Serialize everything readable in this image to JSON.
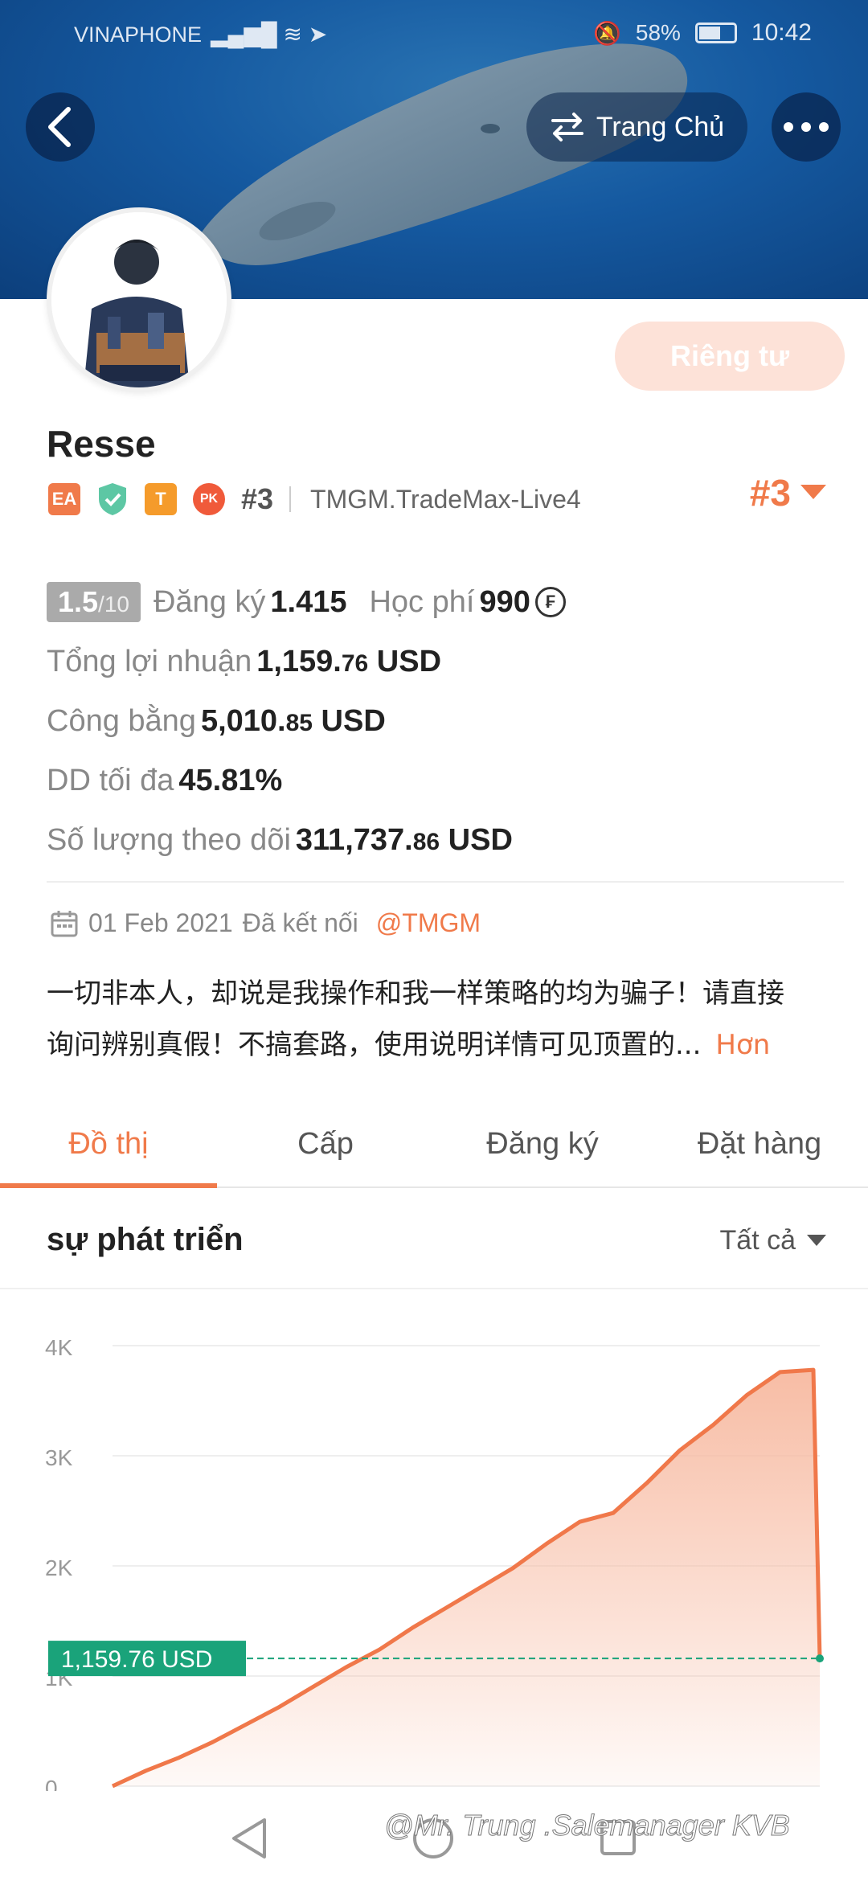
{
  "status_bar": {
    "carrier": "VINAPHONE",
    "battery": "58%",
    "time": "10:42"
  },
  "header": {
    "home_label": "Trang Chủ",
    "private_label": "Riêng tư"
  },
  "profile": {
    "name": "Resse",
    "badges": [
      "EA",
      "T",
      "PK"
    ],
    "rank_small": "#3",
    "server": "TMGM.TradeMax-Live4",
    "rank_big": "#3"
  },
  "stats": {
    "score": "1.5",
    "score_max": "/10",
    "subscribers_label": "Đăng ký",
    "subscribers_value": "1.415",
    "fee_label": "Học phí",
    "fee_value": "990",
    "profit_label": "Tổng lợi nhuận",
    "profit_main": "1,159.",
    "profit_cents": "76",
    "equity_label": "Công bằng",
    "equity_main": "5,010.",
    "equity_cents": "85",
    "dd_label": "DD tối đa",
    "dd_value": "45.81%",
    "follow_label": "Số lượng theo dõi",
    "follow_main": "311,737.",
    "follow_cents": "86",
    "currency": "USD"
  },
  "connect": {
    "date": "01 Feb 2021",
    "text": "Đã kết nối",
    "link": "@TMGM"
  },
  "bio": {
    "line1": "一切非本人，却说是我操作和我一样策略的均为骗子！请直接",
    "line2": "询问辨别真假！不搞套路，使用说明详情可见顶置的...",
    "more": "Hơn"
  },
  "tabs": [
    {
      "label": "Đồ thị",
      "active": true
    },
    {
      "label": "Cấp",
      "active": false
    },
    {
      "label": "Đăng ký",
      "active": false
    },
    {
      "label": "Đặt hàng",
      "active": false
    }
  ],
  "section": {
    "title": "sự phát triển",
    "filter": "Tất cả"
  },
  "chart_data": {
    "type": "area",
    "y_ticks": [
      "4K",
      "3K",
      "2K",
      "1K",
      "0"
    ],
    "ylim": [
      0,
      4000
    ],
    "current_label": "1,159.76 USD",
    "current_value": 1159.76,
    "series": [
      {
        "values": [
          0,
          140,
          260,
          400,
          560,
          720,
          900,
          1080,
          1240,
          1440,
          1620,
          1800,
          1980,
          2200,
          2400,
          2480,
          2750,
          3050,
          3280,
          3550,
          3760,
          3780,
          1159.76
        ]
      }
    ],
    "colors": {
      "line": "#f0784a",
      "fill": "#f7b9a0",
      "ref_line": "#1aa37a",
      "label_bg": "#1aa37a"
    }
  },
  "watermark": "@Mr. Trung .Salemanager KVB"
}
